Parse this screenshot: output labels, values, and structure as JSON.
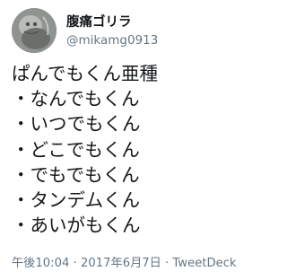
{
  "tweet": {
    "display_name": "腹痛ゴリラ",
    "handle": "@mikamg0913",
    "lines": [
      "ぱんでもくん亜種",
      "・なんでもくん",
      "・いつでもくん",
      "・どこでもくん",
      "・でもでもくん",
      "・タンデムくん",
      "・あいがもくん"
    ],
    "timestamp": "午後10:04 · 2017年6月7日 · TweetDeck"
  },
  "icons": {
    "avatar": "profile-avatar"
  }
}
